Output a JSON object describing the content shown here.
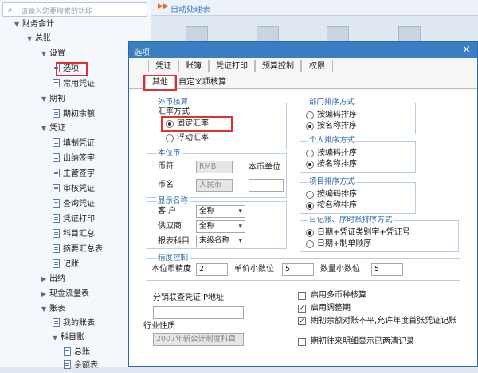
{
  "search": {
    "placeholder": "请输入您要搜索的功能"
  },
  "tree": {
    "finance": "财务会计",
    "gl": "总账",
    "setup": "设置",
    "options": "选项",
    "common_voucher": "常用凭证",
    "period": "期初",
    "period_balance": "期初余额",
    "voucher": "凭证",
    "fill_voucher": "填制凭证",
    "cashier_sign": "出纳签字",
    "manager_sign": "主管签字",
    "audit_voucher": "审核凭证",
    "query_voucher": "查询凭证",
    "print_voucher": "凭证打印",
    "subject_summary": "科目汇总",
    "summary_table": "摘要汇总表",
    "journal": "记账",
    "cashier": "出纳",
    "cashflow": "现金流量表",
    "ledger": "账表",
    "my_ledger": "我的账表",
    "subject_ledger": "科目账",
    "general_ledger": "总账",
    "balance_table": "余额表"
  },
  "topbar": {
    "title": "自动处理表"
  },
  "dialog": {
    "title": "选项",
    "close": "×",
    "tabs_row1": [
      "凭证",
      "账簿",
      "凭证打印",
      "预算控制",
      "权限"
    ],
    "tabs_row2": [
      "其他",
      "自定义项核算"
    ],
    "foreign": {
      "title": "外币核算",
      "rate_label": "汇率方式",
      "fixed": "固定汇率",
      "floating": "浮动汇率"
    },
    "base_currency": {
      "title": "本位币",
      "symbol_label": "币符",
      "symbol_value": "RMB",
      "name_label": "币名",
      "name_value": "人民币",
      "unit_label": "本币单位"
    },
    "display": {
      "title": "显示名称",
      "customer_label": "客  户",
      "customer_value": "全称",
      "supplier_label": "供应商",
      "supplier_value": "全称",
      "subject_label": "报表科目",
      "subject_value": "末级名称"
    },
    "dept_sort": {
      "title": "部门排序方式",
      "opt1": "按编码排序",
      "opt2": "按名称排序"
    },
    "person_sort": {
      "title": "个人排序方式",
      "opt1": "按编码排序",
      "opt2": "按名称排序"
    },
    "project_sort": {
      "title": "项目排序方式",
      "opt1": "按编码排序",
      "opt2": "按名称排序"
    },
    "journal_sort": {
      "title": "日记账、序时账排序方式",
      "opt1": "日期+凭证类别字+凭证号",
      "opt2": "日期+制单顺序"
    },
    "precision": {
      "title": "精度控制",
      "base_label": "本位币精度",
      "base_value": "2",
      "price_label": "单价小数位",
      "price_value": "5",
      "qty_label": "数量小数位",
      "qty_value": "5"
    },
    "ip_label": "分销联查凭证IP地址",
    "industry_label": "行业性质",
    "industry_value": "2007年新会计制度科目",
    "checks": [
      {
        "label": "启用多币种核算",
        "checked": false
      },
      {
        "label": "启用调整期",
        "checked": true
      },
      {
        "label": "期初余额对账不平,允许年度首张凭证记账",
        "checked": true
      },
      {
        "label": "期初往来明细显示已两清记录",
        "checked": false
      }
    ]
  }
}
